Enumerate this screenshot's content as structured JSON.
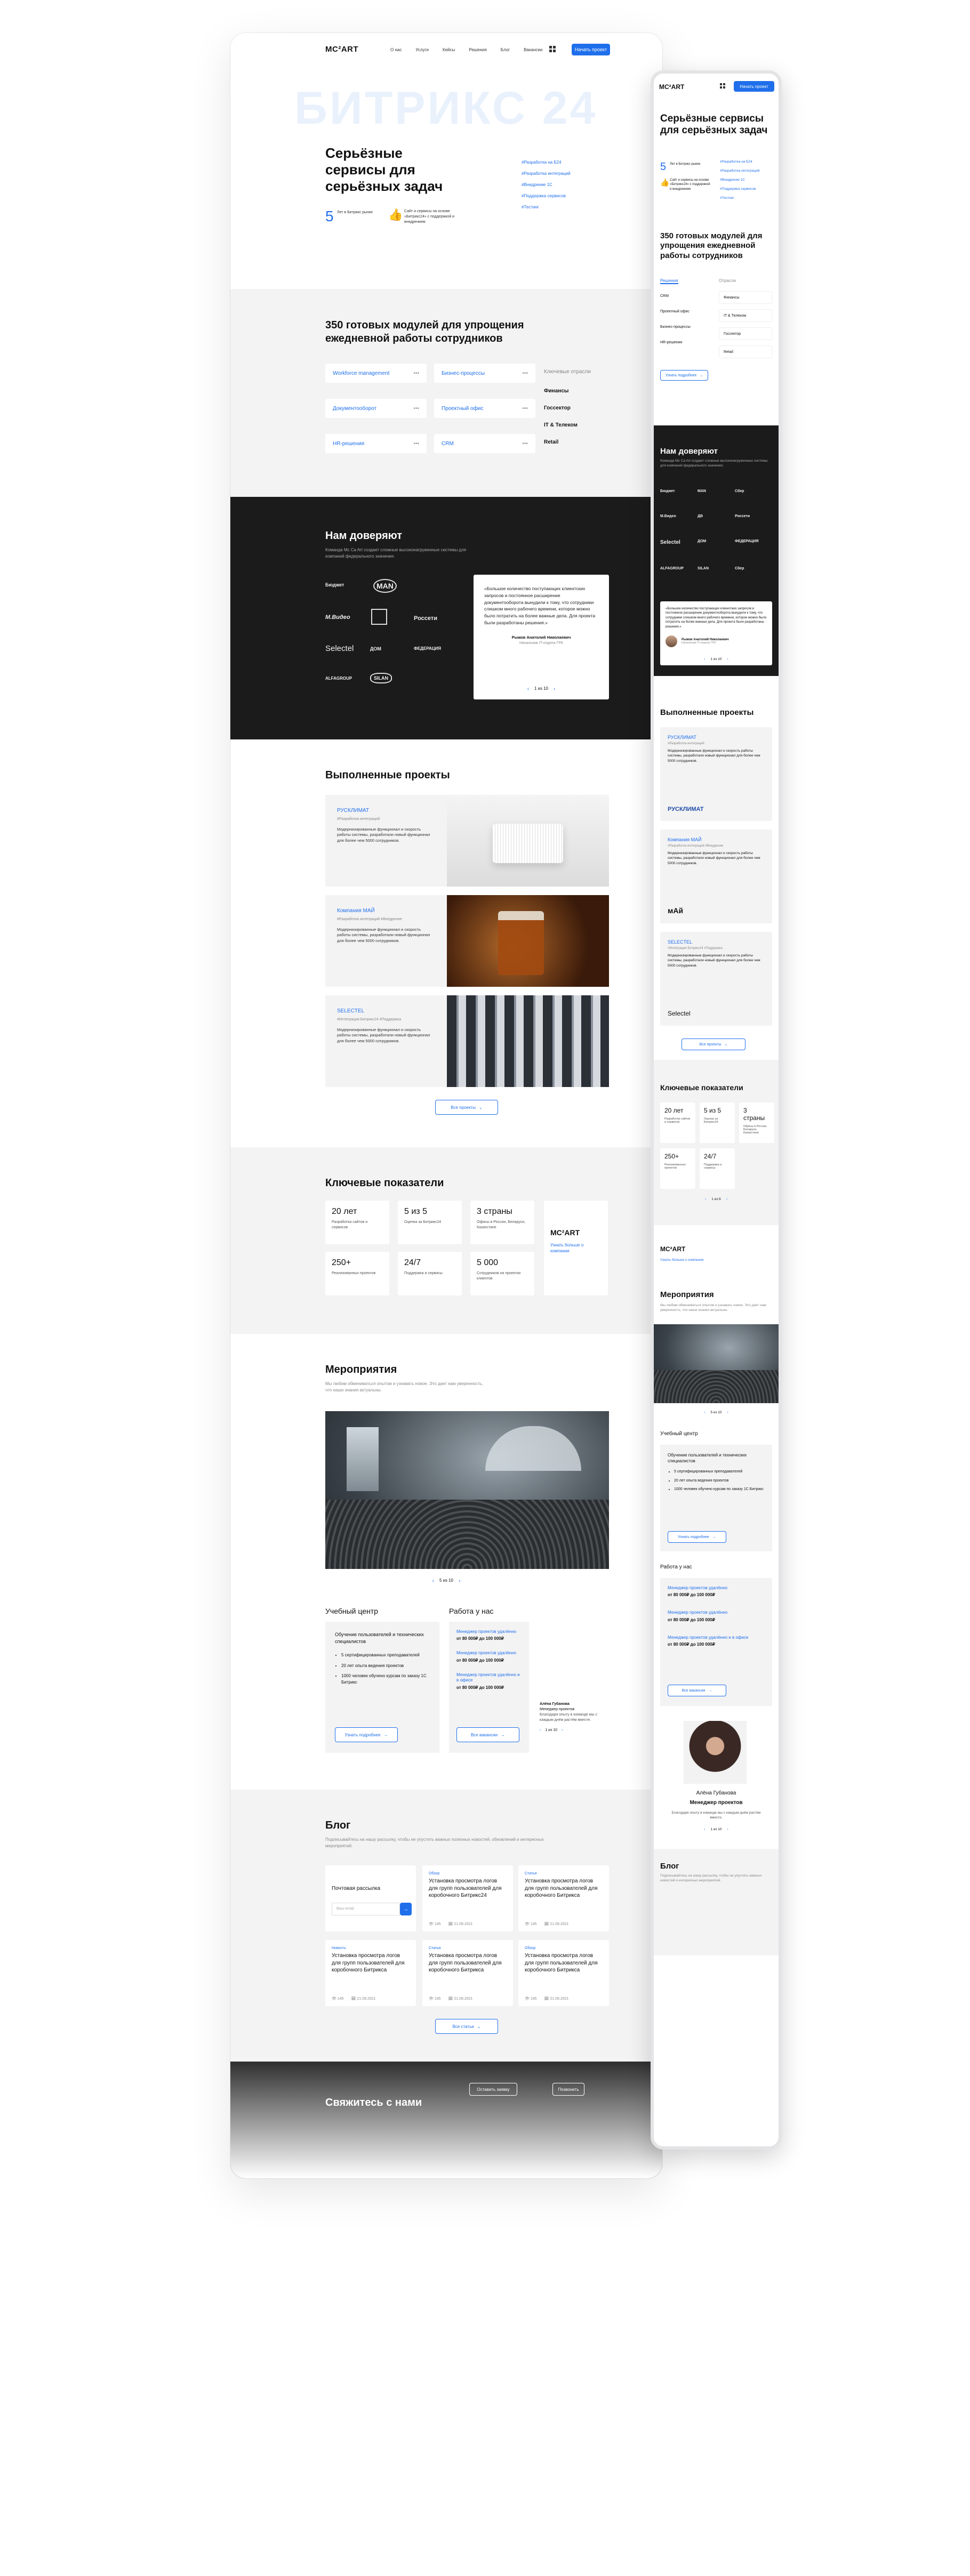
{
  "colors": {
    "accent": "#1f6feb",
    "dark": "#1b1b1b",
    "light_bg": "#f3f3f4"
  },
  "header": {
    "logo": "MC²ART",
    "nav": [
      "О нас",
      "Услуги",
      "Кейсы",
      "Решения",
      "Блог",
      "Вакансии"
    ],
    "grid_icon": "grid-icon",
    "cta": "Начать проект"
  },
  "hero": {
    "watermark": "БИТРИКС 24",
    "title": "Серьёзные сервисы для серьёзных задач",
    "stat_num": "5",
    "stat_text": "Лет в Битрикс рынке",
    "thumb_text": "Сайт и сервисы на основе «Битрикс24» с поддержкой и внедрением",
    "links": [
      "#Разработка на Б24",
      "#Разработка интеграций",
      "#Внедрение 1С",
      "#Поддержка сервисов",
      "#Тестинг",
      "#Отраслевые"
    ]
  },
  "modules": {
    "title": "350 готовых модулей для упрощения ежедневной работы сотрудников",
    "left": [
      "Workforce management",
      "Документооборот",
      "HR-решения"
    ],
    "right": [
      "Бизнес-процессы",
      "Проектный офис",
      "CRM"
    ],
    "industries_title": "Ключевые отрасли",
    "industries": [
      "Финансы",
      "Госсектор",
      "IT & Телеком",
      "Retail"
    ]
  },
  "trust": {
    "title": "Нам доверяют",
    "subtitle": "Команда Mc Ca Art создает сложные высоконагруженные системы для компаний федерального значения.",
    "logos": [
      "Бюджет",
      "MAN",
      "Сбер",
      "M.Видео",
      "ДВ",
      "Россети",
      "Selectel",
      "ДОМ",
      "ФЕДЕРАЦИЯ",
      "ALFAGROUP",
      "SILAN"
    ],
    "quote": "«Большое количество поступающих клиентских запросов и постоянное расширение документооборота вынудили к тому, что сотрудники слишком много рабочего времени, которое можно было потратить на более важные дела. Для проекта были разработаны решения.»",
    "author": "Рыжов Анатолий Николаевич",
    "author_role": "Начальник IT-отдела ГРК",
    "pager": "1 из 10"
  },
  "projects": {
    "title": "Выполненные проекты",
    "items": [
      {
        "name": "РУСКЛИМАТ",
        "tag": "#Разработка интеграций",
        "desc": "Модернизированные функционал и скорость работы системы, разработали новый функционал для более чем 5000 сотрудников."
      },
      {
        "name": "Компания МАЙ",
        "tag": "#Разработка интеграций #Внедрение",
        "desc": "Модернизированные функционал и скорость работы системы, разработали новый функционал для более чем 5000 сотрудников."
      },
      {
        "name": "SELECTEL",
        "tag": "#Интеграция Битрикс24 #Поддержка",
        "desc": "Модернизированные функционал и скорость работы системы, разработали новый функционал для более чем 5000 сотрудников."
      }
    ],
    "more": "Все проекты"
  },
  "kpi": {
    "title": "Ключевые показатели",
    "items": [
      {
        "v": "20 лет",
        "d": "Разработка сайтов и сервисов"
      },
      {
        "v": "5 из 5",
        "d": "Оценка за Битрикс24"
      },
      {
        "v": "3 страны",
        "d": "Офисы в России, Беларуси, Казахстане"
      },
      {
        "v": "250+",
        "d": "Реализованных проектов"
      },
      {
        "v": "24/7",
        "d": "Поддержка и сервисы"
      },
      {
        "v": "5 000",
        "d": "Сотрудников на проектах клиентов"
      }
    ],
    "logo": "MC²ART",
    "link": "Узнать больше о компании"
  },
  "events": {
    "title": "Мероприятия",
    "subtitle": "Мы любим обмениваться опытом и узнавать новое. Это дает нам уверенность, что наши знания актуальны.",
    "pager": "5 из 10",
    "training_title": "Учебный центр",
    "training_text": "Обучение пользователей и технических специалистов",
    "training_list": [
      "5 сертифицированных преподавателей",
      "20 лет опыта ведения проектов",
      "1000 человек обучено курсам по заказу 1С Битрикс"
    ],
    "training_btn": "Узнать подробнее",
    "work_title": "Работа у нас",
    "vacancies": [
      {
        "name": "Менеджер проектов удалённо",
        "sal": "от 80 000₽ до 100 000₽"
      },
      {
        "name": "Менеджер проектов удалённо",
        "sal": "от 80 000₽ до 100 000₽"
      },
      {
        "name": "Менеджер проектов удалённо и в офисе",
        "sal": "от 80 000₽ до 100 000₽"
      }
    ],
    "work_btn": "Все вакансии",
    "person_name": "Алёна Губанова",
    "person_role": "Менеджер проектов",
    "person_text": "Благодаря опыту в команде мы с каждым днём растём вместе.",
    "person_pager": "1 из 10"
  },
  "blog": {
    "title": "Блог",
    "subtitle": "Подписывайтесь на нашу рассылку, чтобы не упустить важных полезных новостей, обновлений и интересных мероприятий.",
    "subscribe_title": "Почтовая рассылка",
    "subscribe_placeholder": "Ваш email",
    "posts": [
      {
        "cat": "Обзор",
        "t": "Установка просмотра логов для групп пользователей для коробочного Битрикс24"
      },
      {
        "cat": "Статья",
        "t": "Установка просмотра логов для групп пользователей для коробочного Битрикса"
      },
      {
        "cat": "Новость",
        "t": "Установка просмотра логов для групп пользователей для коробочного Битрикса"
      },
      {
        "cat": "Статья",
        "t": "Установка просмотра логов для групп пользователей для коробочного Битрикса"
      },
      {
        "cat": "Обзор",
        "t": "Установка просмотра логов для групп пользователей для коробочного Битрикса"
      }
    ],
    "meta_views": "145",
    "meta_date": "21.09.2021",
    "more": "Все статьи"
  },
  "footer": {
    "title": "Свяжитесь с нами",
    "btn1": "Оставить заявку",
    "btn2": "Позвонить"
  },
  "mobile": {
    "modules_title": "350 готовых модулей для упрощения ежедневной работы сотрудников",
    "tab1": "Решения",
    "tab2": "Отрасли",
    "left": [
      "CRM",
      "Проектный офис",
      "Бизнес-процессы",
      "HR-решения"
    ],
    "right": [
      "Финансы",
      "IT & Телеком",
      "Госсектор",
      "Retail"
    ],
    "btn": "Узнать подробнее",
    "kpi_pager": "1 из 6",
    "events_pager": "5 из 10",
    "blog_subtitle": "Подписывайтесь на нашу рассылку, чтобы не упустить важных новостей и интересных мероприятий."
  }
}
